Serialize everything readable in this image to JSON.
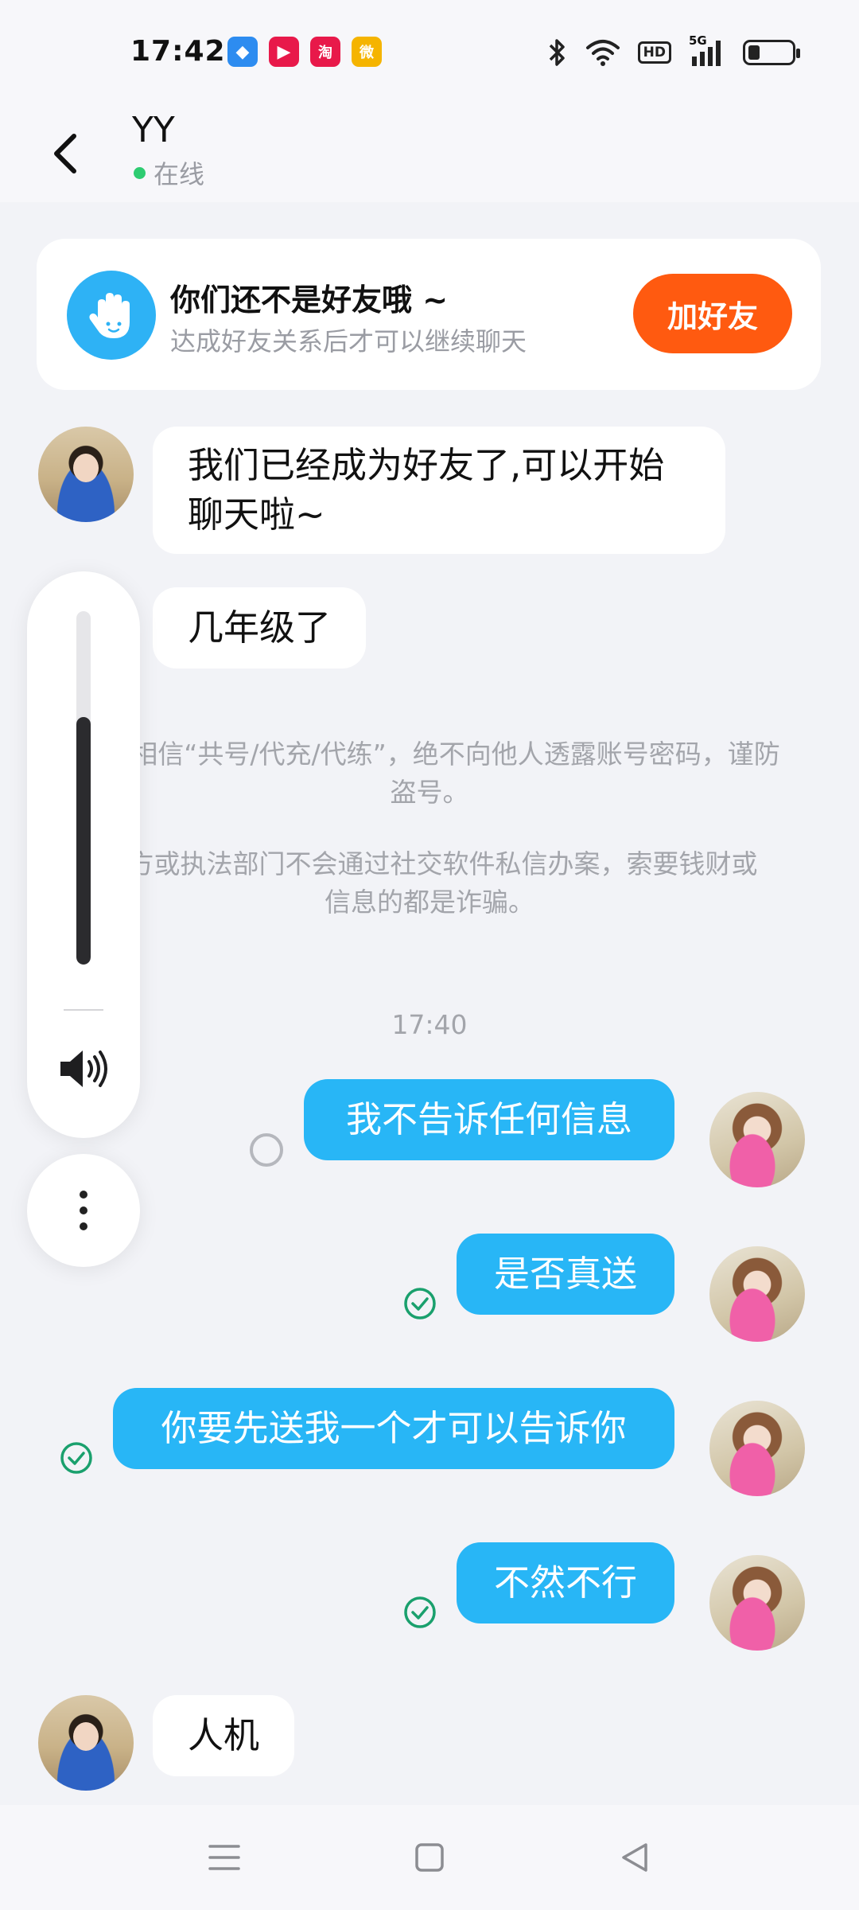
{
  "status_bar": {
    "time": "17:42",
    "notifications": [
      {
        "icon": "app-blue-icon",
        "color": "#2d8cf0",
        "glyph": "◆"
      },
      {
        "icon": "video-play-icon",
        "color": "#e8194a",
        "glyph": "▶"
      },
      {
        "icon": "taobao-icon",
        "color": "#e8194a",
        "glyph": "淘"
      },
      {
        "icon": "weibo-icon",
        "color": "#f5b400",
        "glyph": "微"
      }
    ],
    "network_badge": "HD",
    "signal_label": "5G"
  },
  "header": {
    "contact_name": "YY",
    "status": "在线"
  },
  "friend_banner": {
    "title": "你们还不是好友哦 ~",
    "subtitle": "达成好友关系后才可以继续聊天",
    "button": "加好友"
  },
  "messages": {
    "m1_line1": "我们已经成为好友了,可以开始",
    "m1_line2": "聊天啦~",
    "m2": "几年级了",
    "notice1_line1": "不要相信“共号/代充/代练”，绝不向他人透露账号密码，谨防",
    "notice1_line2": "盗号。",
    "notice2_line1": "官方或执法部门不会通过社交软件私信办案，索要钱财或",
    "notice2_line2": "信息的都是诈骗。",
    "timestamp": "17:40",
    "m3": "我不告诉任何信息",
    "m4": "是否真送",
    "m5": "你要先送我一个才可以告诉你",
    "m6": "不然不行",
    "m7": "人机"
  },
  "volume": {
    "level": 0.7
  },
  "colors": {
    "accent_blue": "#28b6f6",
    "add_friend_orange": "#ff5a10",
    "online_green": "#2ecc71",
    "read_check_green": "#1aa06d"
  }
}
